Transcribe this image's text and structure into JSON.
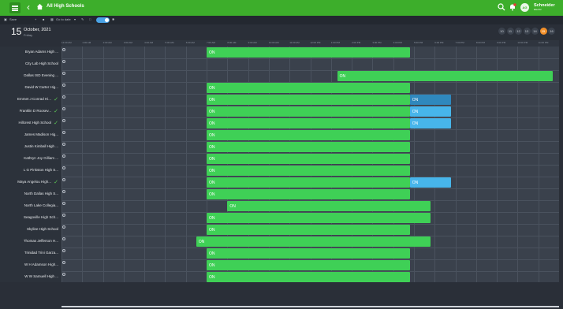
{
  "topbar": {
    "title": "All High Schools",
    "logo_line1": "Schneider",
    "logo_line2": "Electric",
    "avatar": "AG",
    "brand_color": "#3dae2b"
  },
  "toolbar": {
    "save_label": "Save",
    "goto_label": "Go to date"
  },
  "date": {
    "day": "15",
    "month_year": "October, 2021",
    "weekday": "Friday"
  },
  "day_pills": [
    "10",
    "11",
    "12",
    "13",
    "14",
    "15",
    "16"
  ],
  "active_day": "15",
  "hours": [
    "12:00 AM",
    "1:00 AM",
    "2:00 AM",
    "3:00 AM",
    "4:00 AM",
    "5:00 AM",
    "6:00 AM",
    "7:00 AM",
    "8:00 AM",
    "9:00 AM",
    "10:00 AM",
    "11:00 AM",
    "12:00 PM",
    "1:00 PM",
    "2:00 PM",
    "3:00 PM",
    "4:00 PM",
    "5:00 PM",
    "6:00 PM",
    "7:00 PM",
    "8:00 PM",
    "9:00 PM",
    "10:00 PM",
    "11:00 PM"
  ],
  "rows": [
    {
      "name": "Bryan Adams High ...",
      "check": false,
      "segments": [
        {
          "label": "ON",
          "start": 7.0,
          "end": 16.8,
          "kind": "on"
        }
      ]
    },
    {
      "name": "City Lab High School",
      "check": false,
      "segments": []
    },
    {
      "name": "Dallas ISD Evening ...",
      "check": false,
      "segments": [
        {
          "label": "ON",
          "start": 13.3,
          "end": 23.7,
          "kind": "on"
        }
      ]
    },
    {
      "name": "David W Carter Hig...",
      "check": false,
      "segments": [
        {
          "label": "ON",
          "start": 7.0,
          "end": 16.8,
          "kind": "on"
        }
      ]
    },
    {
      "name": "Emmet J Conrad Hi...",
      "check": true,
      "segments": [
        {
          "label": "ON",
          "start": 7.0,
          "end": 16.8,
          "kind": "on"
        },
        {
          "label": "ON",
          "start": 16.8,
          "end": 18.8,
          "kind": "ovd"
        }
      ]
    },
    {
      "name": "Franklin D Roosev...",
      "check": true,
      "segments": [
        {
          "label": "ON",
          "start": 7.0,
          "end": 16.8,
          "kind": "on"
        },
        {
          "label": "ON",
          "start": 16.8,
          "end": 18.8,
          "kind": "ov"
        }
      ]
    },
    {
      "name": "Hillcrest High School",
      "check": true,
      "segments": [
        {
          "label": "ON",
          "start": 7.0,
          "end": 16.8,
          "kind": "on"
        },
        {
          "label": "ON",
          "start": 16.8,
          "end": 18.8,
          "kind": "ov"
        }
      ]
    },
    {
      "name": "James Madison Hig...",
      "check": false,
      "segments": [
        {
          "label": "ON",
          "start": 7.0,
          "end": 16.8,
          "kind": "on"
        }
      ]
    },
    {
      "name": "Justin Kimball High ...",
      "check": false,
      "segments": [
        {
          "label": "ON",
          "start": 7.0,
          "end": 16.8,
          "kind": "on"
        }
      ]
    },
    {
      "name": "Kathryn Joy Gilliam ...",
      "check": false,
      "segments": [
        {
          "label": "ON",
          "start": 7.0,
          "end": 16.8,
          "kind": "on"
        }
      ]
    },
    {
      "name": "L G Pinkston High S...",
      "check": false,
      "segments": [
        {
          "label": "ON",
          "start": 7.0,
          "end": 16.8,
          "kind": "on"
        }
      ]
    },
    {
      "name": "Maya Angelou High...",
      "check": true,
      "segments": [
        {
          "label": "ON",
          "start": 7.0,
          "end": 16.8,
          "kind": "on"
        },
        {
          "label": "ON",
          "start": 16.8,
          "end": 18.8,
          "kind": "ov"
        }
      ]
    },
    {
      "name": "North Dallas High S...",
      "check": false,
      "segments": [
        {
          "label": "ON",
          "start": 7.0,
          "end": 16.8,
          "kind": "on"
        }
      ]
    },
    {
      "name": "North Lake Collegia...",
      "check": false,
      "segments": [
        {
          "label": "ON",
          "start": 8.0,
          "end": 17.8,
          "kind": "on"
        }
      ]
    },
    {
      "name": "Seagoville High Sch...",
      "check": false,
      "segments": [
        {
          "label": "ON",
          "start": 7.0,
          "end": 17.8,
          "kind": "on"
        }
      ]
    },
    {
      "name": "Skyline High School",
      "check": false,
      "segments": [
        {
          "label": "ON",
          "start": 7.0,
          "end": 16.8,
          "kind": "on"
        }
      ]
    },
    {
      "name": "Thomas Jefferson H...",
      "check": false,
      "segments": [
        {
          "label": "ON",
          "start": 6.5,
          "end": 17.8,
          "kind": "on"
        }
      ]
    },
    {
      "name": "Trinidad Trini Garza...",
      "check": false,
      "segments": [
        {
          "label": "ON",
          "start": 7.0,
          "end": 16.8,
          "kind": "on"
        }
      ]
    },
    {
      "name": "W H Adamson High...",
      "check": false,
      "segments": [
        {
          "label": "ON",
          "start": 7.0,
          "end": 16.8,
          "kind": "on"
        }
      ]
    },
    {
      "name": "W W Samuell High ...",
      "check": false,
      "segments": [
        {
          "label": "ON",
          "start": 7.0,
          "end": 16.8,
          "kind": "on"
        }
      ]
    }
  ]
}
